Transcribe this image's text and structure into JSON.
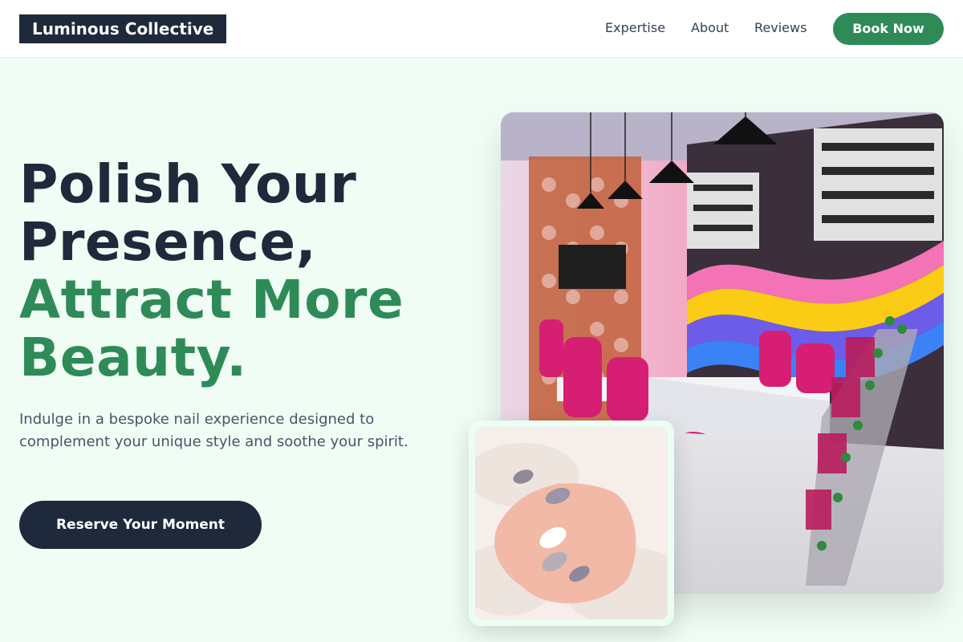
{
  "header": {
    "logo": "Luminous Collective",
    "nav": [
      "Expertise",
      "About",
      "Reviews"
    ],
    "book_label": "Book Now"
  },
  "hero": {
    "title_lines": [
      "Polish Your",
      "Presence,",
      "Attract More",
      "Beauty."
    ],
    "subtitle": "Indulge in a bespoke nail experience designed to complement your unique style and soothe your spirit.",
    "cta_label": "Reserve Your Moment"
  },
  "images": {
    "main_alt": "nail-salon-interior-photo",
    "overlay_alt": "manicured-hand-on-knit-photo"
  },
  "colors": {
    "accent": "#2e8b57",
    "dark": "#1e293b",
    "background": "#f0fdf4"
  }
}
